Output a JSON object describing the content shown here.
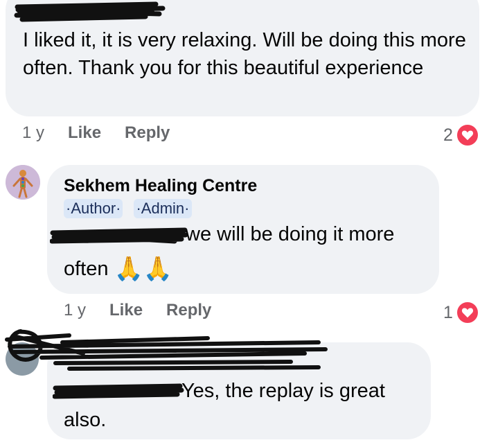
{
  "comments": [
    {
      "text": "I liked it, it is very relaxing. Will be doing this more often. Thank you for this beautiful experience",
      "time": "1 y",
      "like_label": "Like",
      "reply_label": "Reply",
      "reaction_count": "2",
      "reaction_icon": "heart-icon"
    },
    {
      "author": "Sekhem Healing Centre",
      "badges": [
        "·Author·",
        "·Admin·"
      ],
      "text_line1": "we will be doing it more",
      "text_line2": "often",
      "emoji": "🙏🙏",
      "time": "1 y",
      "like_label": "Like",
      "reply_label": "Reply",
      "reaction_count": "1",
      "reaction_icon": "heart-icon"
    },
    {
      "text_line1": "Yes,  the replay is great",
      "text_line2": "also."
    }
  ],
  "colors": {
    "bubble": "#f0f2f5",
    "meta_text": "#65676b",
    "heart": "#f33e58",
    "badge_bg": "#dbe7f7"
  }
}
